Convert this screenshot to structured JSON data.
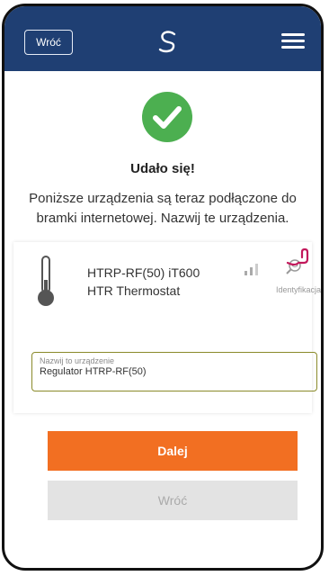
{
  "header": {
    "back_label": "Wróć",
    "logo_icon": "logo-icon",
    "menu_icon": "hamburger-menu-icon",
    "color": "#1f3f73"
  },
  "status": {
    "icon": "checkmark-icon",
    "title": "Udało się!",
    "description": "Poniższe urządzenia są teraz podłączone do bramki internetowej. Nazwij te urządzenia."
  },
  "device": {
    "icon": "thermometer-icon",
    "name": "HTRP-RF(50) iT600",
    "type": "HTR Thermostat",
    "signal_icon": "signal-strength-icon",
    "identify_icon": "identify-icon",
    "identify_label": "Identyfikacja",
    "name_field": {
      "label": "Nazwij to urządzenie",
      "value": "Regulator HTRP-RF(50)"
    }
  },
  "buttons": {
    "next_label": "Dalej",
    "back_label": "Wróć",
    "next_color": "#f26f22"
  }
}
